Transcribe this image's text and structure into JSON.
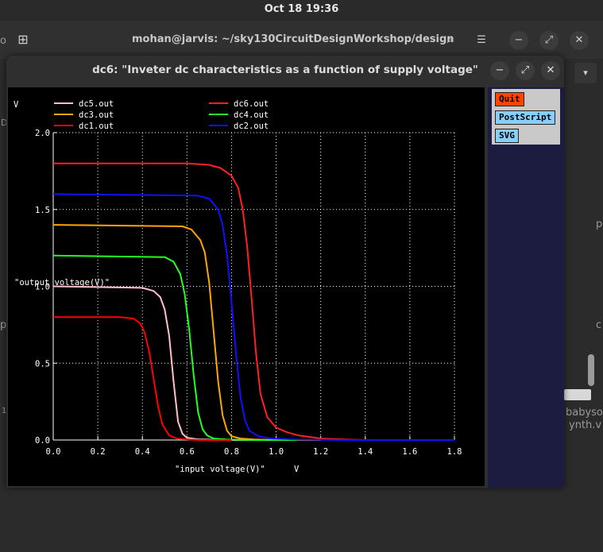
{
  "topbar": {
    "datetime": "Oct 18  19:36"
  },
  "terminal": {
    "title": "mohan@jarvis: ~/sky130CircuitDesignWorkshop/design",
    "side_fragments": {
      "left_1": "o",
      "left_2": "D",
      "left_3": "p",
      "left_4": "1",
      "right_1": "p",
      "right_2": "c",
      "right_3": "babysoc",
      "right_4": "ynth.v"
    }
  },
  "dc_window": {
    "title": "dc6: \"Inveter dc characteristics as a function of supply voltage\"",
    "buttons": {
      "quit": "Quit",
      "postscript": "PostScript",
      "svg": "SVG"
    }
  },
  "chart_data": {
    "type": "line",
    "title": "",
    "xlabel": "\"input voltage(V)\"",
    "xunit": "V",
    "ylabel": "\"output voltage(V)\"",
    "yunit": "V",
    "xlim": [
      0,
      1.8
    ],
    "ylim": [
      0,
      2.0
    ],
    "xticks": [
      "0.0",
      "0.2",
      "0.4",
      "0.6",
      "0.8",
      "1.0",
      "1.2",
      "1.4",
      "1.6",
      "1.8"
    ],
    "yticks": [
      "0.0",
      "0.5",
      "1.0",
      "1.5",
      "2.0"
    ],
    "grid": true,
    "series": [
      {
        "name": "dc5.out",
        "color": "#ffc0cb",
        "x": [
          0,
          0.4,
          0.45,
          0.48,
          0.5,
          0.52,
          0.54,
          0.56,
          0.58,
          0.6,
          0.65,
          0.8,
          1.0
        ],
        "y": [
          1.0,
          0.99,
          0.97,
          0.93,
          0.85,
          0.68,
          0.38,
          0.12,
          0.04,
          0.015,
          0.004,
          0.0,
          0.0
        ]
      },
      {
        "name": "dc6.out",
        "color": "#ff2020",
        "x": [
          0,
          0.6,
          0.7,
          0.75,
          0.8,
          0.83,
          0.85,
          0.87,
          0.89,
          0.91,
          0.93,
          0.96,
          1.0,
          1.05,
          1.1,
          1.15,
          1.2,
          1.3,
          1.4,
          1.8
        ],
        "y": [
          1.8,
          1.8,
          1.79,
          1.77,
          1.72,
          1.64,
          1.5,
          1.26,
          0.92,
          0.56,
          0.3,
          0.15,
          0.08,
          0.05,
          0.03,
          0.02,
          0.01,
          0.004,
          0.0,
          0.0
        ]
      },
      {
        "name": "dc3.out",
        "color": "#ffa500",
        "x": [
          0,
          0.58,
          0.62,
          0.66,
          0.68,
          0.7,
          0.72,
          0.74,
          0.76,
          0.78,
          0.8,
          0.84,
          0.9,
          1.0,
          1.2
        ],
        "y": [
          1.4,
          1.39,
          1.37,
          1.3,
          1.22,
          1.02,
          0.7,
          0.38,
          0.16,
          0.06,
          0.025,
          0.01,
          0.004,
          0.0,
          0.0
        ]
      },
      {
        "name": "dc4.out",
        "color": "#20ff20",
        "x": [
          0,
          0.5,
          0.54,
          0.57,
          0.59,
          0.61,
          0.63,
          0.65,
          0.67,
          0.69,
          0.72,
          0.78,
          0.9,
          1.1
        ],
        "y": [
          1.2,
          1.19,
          1.16,
          1.08,
          0.95,
          0.72,
          0.42,
          0.18,
          0.07,
          0.03,
          0.01,
          0.003,
          0.0,
          0.0
        ]
      },
      {
        "name": "dc1.out",
        "color": "#ff0000",
        "x": [
          0,
          0.3,
          0.36,
          0.39,
          0.41,
          0.43,
          0.45,
          0.47,
          0.49,
          0.52,
          0.56,
          0.65,
          0.8
        ],
        "y": [
          0.8,
          0.8,
          0.79,
          0.76,
          0.7,
          0.58,
          0.4,
          0.22,
          0.1,
          0.03,
          0.008,
          0.0,
          0.0
        ]
      },
      {
        "name": "dc2.out",
        "color": "#1010ff",
        "x": [
          0,
          0.65,
          0.7,
          0.74,
          0.76,
          0.78,
          0.8,
          0.82,
          0.84,
          0.86,
          0.88,
          0.92,
          0.98,
          1.1,
          1.3,
          1.8
        ],
        "y": [
          1.6,
          1.59,
          1.57,
          1.5,
          1.4,
          1.2,
          0.9,
          0.56,
          0.28,
          0.13,
          0.06,
          0.025,
          0.01,
          0.003,
          0.0,
          0.0
        ]
      }
    ]
  }
}
